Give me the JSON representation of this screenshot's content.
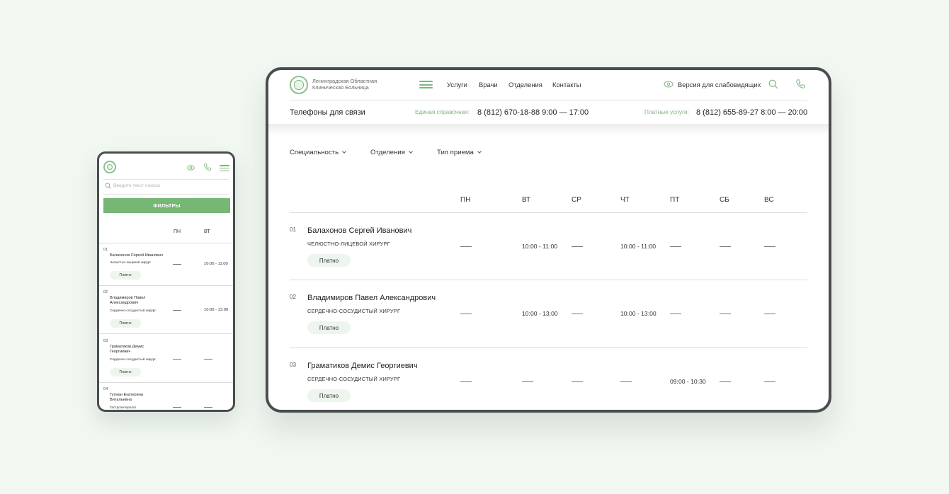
{
  "desktop": {
    "logo_line1": "Ленинградская Областная",
    "logo_line2": "Клиническая Больница",
    "nav": [
      "Услуги",
      "Врачи",
      "Отделения",
      "Контакты"
    ],
    "accessibility": "Версия для слабовидящих",
    "phones_title": "Телефоны для связи",
    "info_label": "Единая справочная:",
    "info_number": "8 (812) 670-18-88  9:00 — 17:00",
    "paid_label": "Платные услуги:",
    "paid_number": "8 (812) 655-89-27  8:00 — 20:00",
    "filters": [
      "Специальность",
      "Отделения",
      "Тип приема"
    ],
    "days": [
      "ПН",
      "ВТ",
      "СР",
      "ЧТ",
      "ПТ",
      "СБ",
      "ВС"
    ],
    "rows": [
      {
        "num": "01",
        "name": "Балахонов Сергей Иванович",
        "spec": "ЧЕЛЮСТНО-ЛИЦЕВОЙ ХИРУРГ",
        "badge": "Платно",
        "schedule": [
          "—",
          "10:00 - 11:00",
          "—",
          "10:00 - 11:00",
          "—",
          "—",
          "—"
        ]
      },
      {
        "num": "02",
        "name": "Владимиров Павел Александрович",
        "spec": "СЕРДЕЧНО-СОСУДИСТЫЙ ХИРУРГ",
        "badge": "Платно",
        "schedule": [
          "—",
          "10:00 - 13:00",
          "—",
          "10:00 - 13:00",
          "—",
          "—",
          "—"
        ]
      },
      {
        "num": "03",
        "name": "Граматиков Демис Георгиевич",
        "spec": "СЕРДЕЧНО-СОСУДИСТЫЙ ХИРУРГ",
        "badge": "Платно",
        "schedule": [
          "—",
          "—",
          "—",
          "—",
          "09:00 - 10:30",
          "—",
          "—"
        ]
      }
    ]
  },
  "mobile": {
    "search_placeholder": "Введите текст поиска",
    "filters_button": "ФИЛЬТРЫ",
    "days": [
      "ПН",
      "ВТ"
    ],
    "rows": [
      {
        "num": "01",
        "name": "Балахонов Сергей Иванович",
        "spec": "Челюстно-лицевой хирург",
        "badge": "Платно",
        "schedule": [
          "—",
          "10:00 - 11:00"
        ]
      },
      {
        "num": "02",
        "name": "Владимиров Павел Александрович",
        "spec": "Сердечно-сосудистый хирург",
        "badge": "Платно",
        "schedule": [
          "—",
          "10:00 - 13:00"
        ]
      },
      {
        "num": "03",
        "name": "Граматиков Демис Георгиевич",
        "spec": "Сердечно-сосудистый хирург",
        "badge": "Платно",
        "schedule": [
          "—",
          "—"
        ]
      },
      {
        "num": "04",
        "name": "Гутман Екатерина Витальевна",
        "spec": "Гастроэнтеролог",
        "badge": "",
        "schedule": [
          "—",
          "—"
        ]
      }
    ]
  },
  "colors": {
    "accent": "#76b776",
    "background": "#f1f7f1",
    "frame": "#4a4d4f"
  },
  "icons": [
    "logo-icon",
    "burger-menu-icon",
    "eye-icon",
    "search-icon",
    "phone-icon",
    "chevron-down-icon"
  ]
}
